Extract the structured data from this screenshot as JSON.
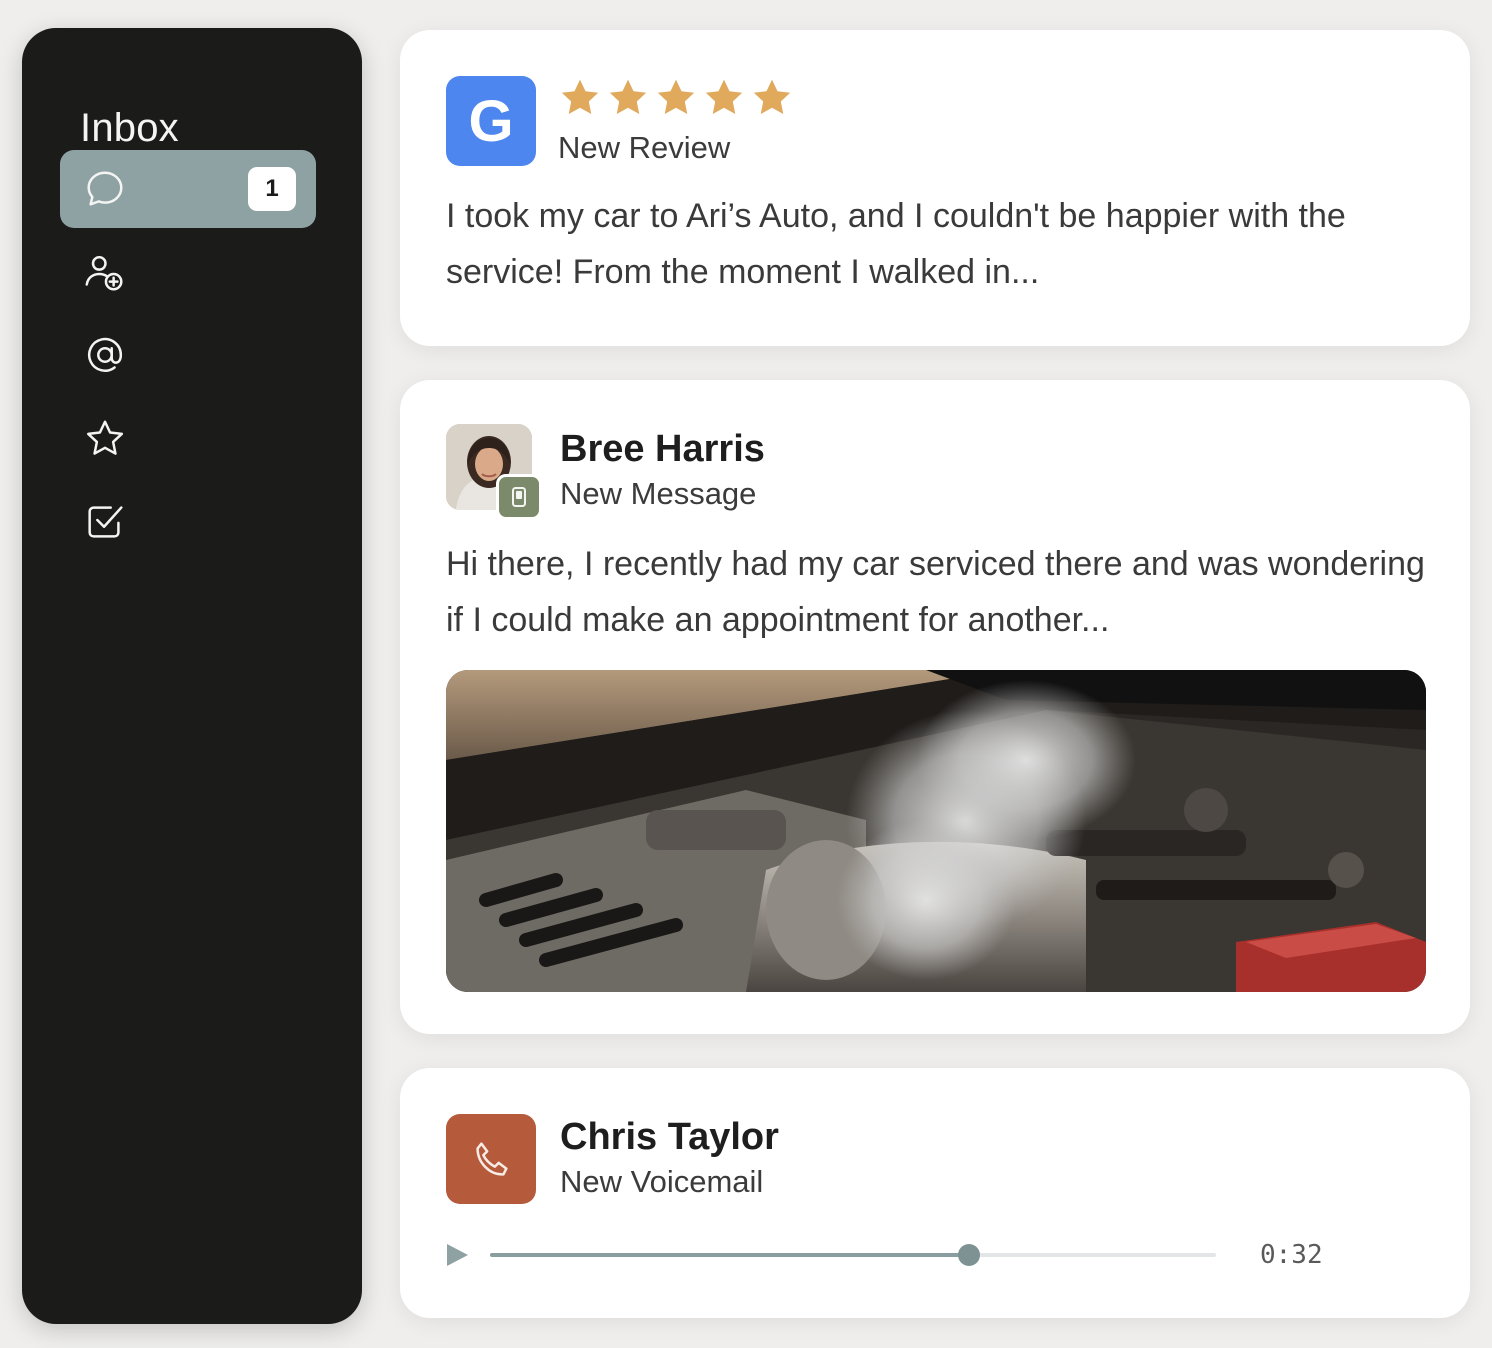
{
  "sidebar": {
    "title": "Inbox",
    "items": [
      {
        "icon": "chat-bubble-icon",
        "active": true,
        "badge": "1"
      },
      {
        "icon": "add-contact-icon",
        "active": false
      },
      {
        "icon": "at-sign-icon",
        "active": false
      },
      {
        "icon": "star-icon",
        "active": false
      },
      {
        "icon": "checkbox-icon",
        "active": false
      }
    ]
  },
  "review": {
    "logo_letter": "G",
    "rating": 5,
    "type_label": "New Review",
    "text": "I took my car to Ari’s Auto, and I couldn't be happier with the service! From the moment I walked in..."
  },
  "message": {
    "sender": "Bree Harris",
    "type_label": "New Message",
    "text": "Hi there, I recently had my car serviced there and was wondering if I could make an appointment for another..."
  },
  "voicemail": {
    "sender": "Chris Taylor",
    "type_label": "New Voicemail",
    "progress": 0.66,
    "duration": "0:32"
  },
  "colors": {
    "sidebar_bg": "#1b1b19",
    "active_item": "#8ea2a4",
    "google_blue": "#4e86f0",
    "star_gold": "#e0a95c",
    "phone_orange": "#b65a3c",
    "sms_green": "#7a8a6a"
  }
}
